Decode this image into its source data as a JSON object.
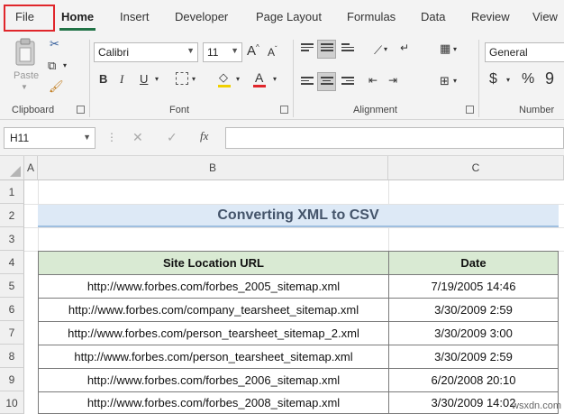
{
  "tabs": [
    "File",
    "Home",
    "Insert",
    "Developer",
    "Page Layout",
    "Formulas",
    "Data",
    "Review",
    "View"
  ],
  "ribbon": {
    "clipboard": {
      "paste_label": "Paste",
      "group_label": "Clipboard"
    },
    "font": {
      "font_name": "Calibri",
      "font_size": "11",
      "group_label": "Font"
    },
    "alignment": {
      "group_label": "Alignment"
    },
    "number": {
      "format": "General",
      "group_label": "Number"
    }
  },
  "formula_bar": {
    "name_box": "H11",
    "fx_symbol": "fx",
    "formula": ""
  },
  "sheet": {
    "columns": [
      "A",
      "B",
      "C"
    ],
    "rows": [
      "1",
      "2",
      "3",
      "4",
      "5",
      "6",
      "7",
      "8",
      "9",
      "10"
    ],
    "title": "Converting XML to CSV",
    "headers": [
      "Site Location URL",
      "Date"
    ],
    "data": [
      [
        "http://www.forbes.com/forbes_2005_sitemap.xml",
        "7/19/2005 14:46"
      ],
      [
        "http://www.forbes.com/company_tearsheet_sitemap.xml",
        "3/30/2009 2:59"
      ],
      [
        "http://www.forbes.com/person_tearsheet_sitemap_2.xml",
        "3/30/2009 3:00"
      ],
      [
        "http://www.forbes.com/person_tearsheet_sitemap.xml",
        "3/30/2009 2:59"
      ],
      [
        "http://www.forbes.com/forbes_2006_sitemap.xml",
        "6/20/2008 20:10"
      ],
      [
        "http://www.forbes.com/forbes_2008_sitemap.xml",
        "3/30/2009 14:02"
      ]
    ]
  },
  "watermark": "wsxdn.com",
  "colors": {
    "accent": "#217346",
    "highlight": "#e0262b",
    "header_fill": "#d9ead3",
    "title_fill": "#dde9f6"
  }
}
